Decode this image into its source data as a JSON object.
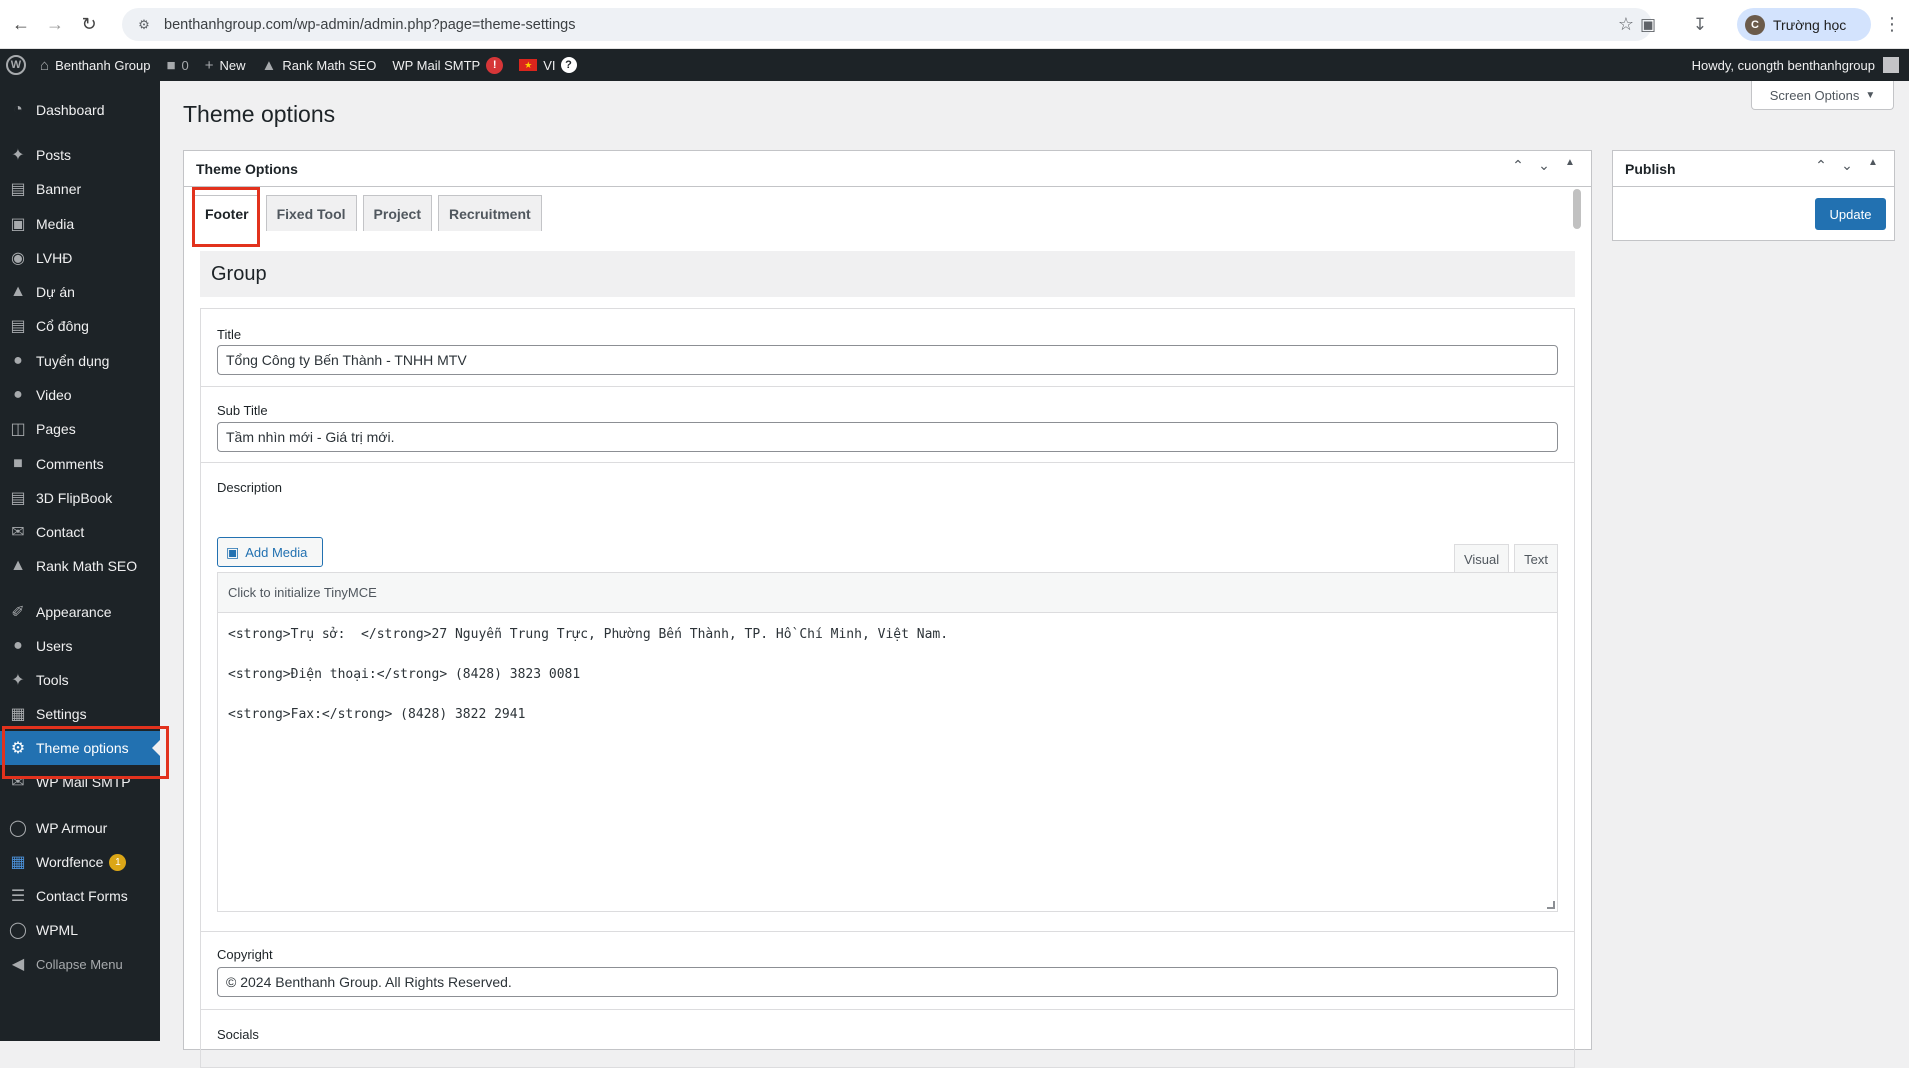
{
  "browser": {
    "url": "benthanhgroup.com/wp-admin/admin.php?page=theme-settings",
    "profile_label": "Trường học",
    "profile_initial": "C"
  },
  "admin_bar": {
    "site_name": "Benthanh Group",
    "comments_count": "0",
    "new_label": "New",
    "rank_math": "Rank Math SEO",
    "wp_mail": "WP Mail SMTP",
    "wp_mail_badge": "!",
    "language": "VI",
    "help": "?",
    "greeting": "Howdy, cuongth benthanhgroup"
  },
  "sidebar": {
    "items": [
      {
        "label": "Dashboard",
        "icon": "dashboard-icon"
      },
      {
        "label": "Posts",
        "icon": "pin-icon"
      },
      {
        "label": "Banner",
        "icon": "banner-icon"
      },
      {
        "label": "Media",
        "icon": "media-icon"
      },
      {
        "label": "LVHĐ",
        "icon": "globe-icon"
      },
      {
        "label": "Dự án",
        "icon": "building-icon"
      },
      {
        "label": "Cổ đông",
        "icon": "page-icon"
      },
      {
        "label": "Tuyển dụng",
        "icon": "user-icon"
      },
      {
        "label": "Video",
        "icon": "user-icon"
      },
      {
        "label": "Pages",
        "icon": "pages-icon"
      },
      {
        "label": "Comments",
        "icon": "comment-icon"
      },
      {
        "label": "3D FlipBook",
        "icon": "book-icon"
      },
      {
        "label": "Contact",
        "icon": "mail-icon"
      },
      {
        "label": "Rank Math SEO",
        "icon": "chart-icon"
      },
      {
        "label": "Appearance",
        "icon": "brush-icon"
      },
      {
        "label": "Users",
        "icon": "user-icon"
      },
      {
        "label": "Tools",
        "icon": "wrench-icon"
      },
      {
        "label": "Settings",
        "icon": "settings-icon"
      },
      {
        "label": "Theme options",
        "icon": "gear-icon"
      },
      {
        "label": "WP Mail SMTP",
        "icon": "mail-icon"
      },
      {
        "label": "WP Armour",
        "icon": "shield-icon"
      },
      {
        "label": "Wordfence",
        "icon": "wordfence-icon",
        "badge": "1"
      },
      {
        "label": "Contact Forms",
        "icon": "form-icon"
      },
      {
        "label": "WPML",
        "icon": "wpml-icon"
      },
      {
        "label": "Collapse Menu",
        "icon": "collapse-icon"
      }
    ]
  },
  "page": {
    "title": "Theme options",
    "screen_options": "Screen Options"
  },
  "theme_box": {
    "header": "Theme Options",
    "tabs": [
      "Footer",
      "Fixed Tool",
      "Project",
      "Recruitment"
    ],
    "group_title": "Group",
    "fields": {
      "title_label": "Title",
      "title_value": "Tổng Công ty Bến Thành - TNHH MTV",
      "subtitle_label": "Sub Title",
      "subtitle_value": "Tầm nhìn mới - Giá trị mới.",
      "description_label": "Description",
      "add_media": "Add Media",
      "visual_tab": "Visual",
      "text_tab": "Text",
      "tinymce_notice": "Click to initialize TinyMCE",
      "editor_lines": [
        "<strong>Trụ sở:  </strong>27 Nguyễn Trung Trực, Phường Bến Thành, TP. Hồ Chí Minh, Việt Nam.",
        "<strong>Điện thoại:</strong> (8428) 3823 0081",
        "<strong>Fax:</strong> (8428) 3822 2941"
      ],
      "copyright_label": "Copyright",
      "copyright_value": "© 2024 Benthanh Group. All Rights Reserved.",
      "socials_label": "Socials"
    }
  },
  "publish_box": {
    "header": "Publish",
    "update": "Update"
  },
  "colors": {
    "accent": "#2271b1",
    "admin_dark": "#1d2327",
    "highlight_red": "#e2321d"
  }
}
